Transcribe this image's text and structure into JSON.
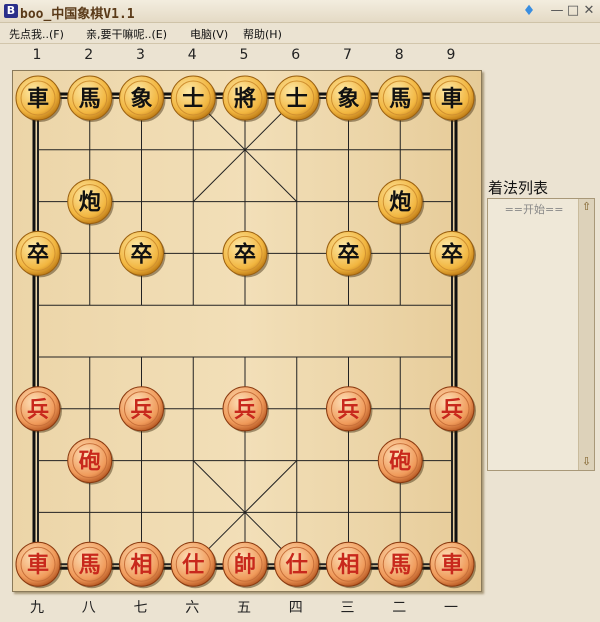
{
  "window": {
    "title": "boo_中国象棋V1.1",
    "app_icon": "B",
    "controls": {
      "skin": "shirt-icon",
      "minimize": "—",
      "maximize": "□",
      "close": "✕"
    }
  },
  "menu": [
    "先点我..(F)",
    "亲,要干嘛呢..(E)",
    "电脑(V)",
    "帮助(H)"
  ],
  "top_labels": [
    "1",
    "2",
    "3",
    "4",
    "5",
    "6",
    "7",
    "8",
    "9"
  ],
  "bottom_labels": [
    "九",
    "八",
    "七",
    "六",
    "五",
    "四",
    "三",
    "二",
    "一"
  ],
  "colors": {
    "black_piece_text": "#111111",
    "red_piece_text": "#c8281c",
    "board": "#e8cf9e"
  },
  "pieces": [
    {
      "c": "車",
      "side": "black",
      "file": 0,
      "rank": 0
    },
    {
      "c": "馬",
      "side": "black",
      "file": 1,
      "rank": 0
    },
    {
      "c": "象",
      "side": "black",
      "file": 2,
      "rank": 0
    },
    {
      "c": "士",
      "side": "black",
      "file": 3,
      "rank": 0
    },
    {
      "c": "將",
      "side": "black",
      "file": 4,
      "rank": 0
    },
    {
      "c": "士",
      "side": "black",
      "file": 5,
      "rank": 0
    },
    {
      "c": "象",
      "side": "black",
      "file": 6,
      "rank": 0
    },
    {
      "c": "馬",
      "side": "black",
      "file": 7,
      "rank": 0
    },
    {
      "c": "車",
      "side": "black",
      "file": 8,
      "rank": 0
    },
    {
      "c": "炮",
      "side": "black",
      "file": 1,
      "rank": 2
    },
    {
      "c": "炮",
      "side": "black",
      "file": 7,
      "rank": 2
    },
    {
      "c": "卒",
      "side": "black",
      "file": 0,
      "rank": 3
    },
    {
      "c": "卒",
      "side": "black",
      "file": 2,
      "rank": 3
    },
    {
      "c": "卒",
      "side": "black",
      "file": 4,
      "rank": 3
    },
    {
      "c": "卒",
      "side": "black",
      "file": 6,
      "rank": 3
    },
    {
      "c": "卒",
      "side": "black",
      "file": 8,
      "rank": 3
    },
    {
      "c": "兵",
      "side": "red",
      "file": 0,
      "rank": 6
    },
    {
      "c": "兵",
      "side": "red",
      "file": 2,
      "rank": 6
    },
    {
      "c": "兵",
      "side": "red",
      "file": 4,
      "rank": 6
    },
    {
      "c": "兵",
      "side": "red",
      "file": 6,
      "rank": 6
    },
    {
      "c": "兵",
      "side": "red",
      "file": 8,
      "rank": 6
    },
    {
      "c": "砲",
      "side": "red",
      "file": 1,
      "rank": 7
    },
    {
      "c": "砲",
      "side": "red",
      "file": 7,
      "rank": 7
    },
    {
      "c": "車",
      "side": "red",
      "file": 0,
      "rank": 9
    },
    {
      "c": "馬",
      "side": "red",
      "file": 1,
      "rank": 9
    },
    {
      "c": "相",
      "side": "red",
      "file": 2,
      "rank": 9
    },
    {
      "c": "仕",
      "side": "red",
      "file": 3,
      "rank": 9
    },
    {
      "c": "帥",
      "side": "red",
      "file": 4,
      "rank": 9
    },
    {
      "c": "仕",
      "side": "red",
      "file": 5,
      "rank": 9
    },
    {
      "c": "相",
      "side": "red",
      "file": 6,
      "rank": 9
    },
    {
      "c": "馬",
      "side": "red",
      "file": 7,
      "rank": 9
    },
    {
      "c": "車",
      "side": "red",
      "file": 8,
      "rank": 9
    }
  ],
  "move_panel": {
    "label": "着法列表",
    "start": "==开始==",
    "up": "⇧",
    "down": "⇩"
  }
}
